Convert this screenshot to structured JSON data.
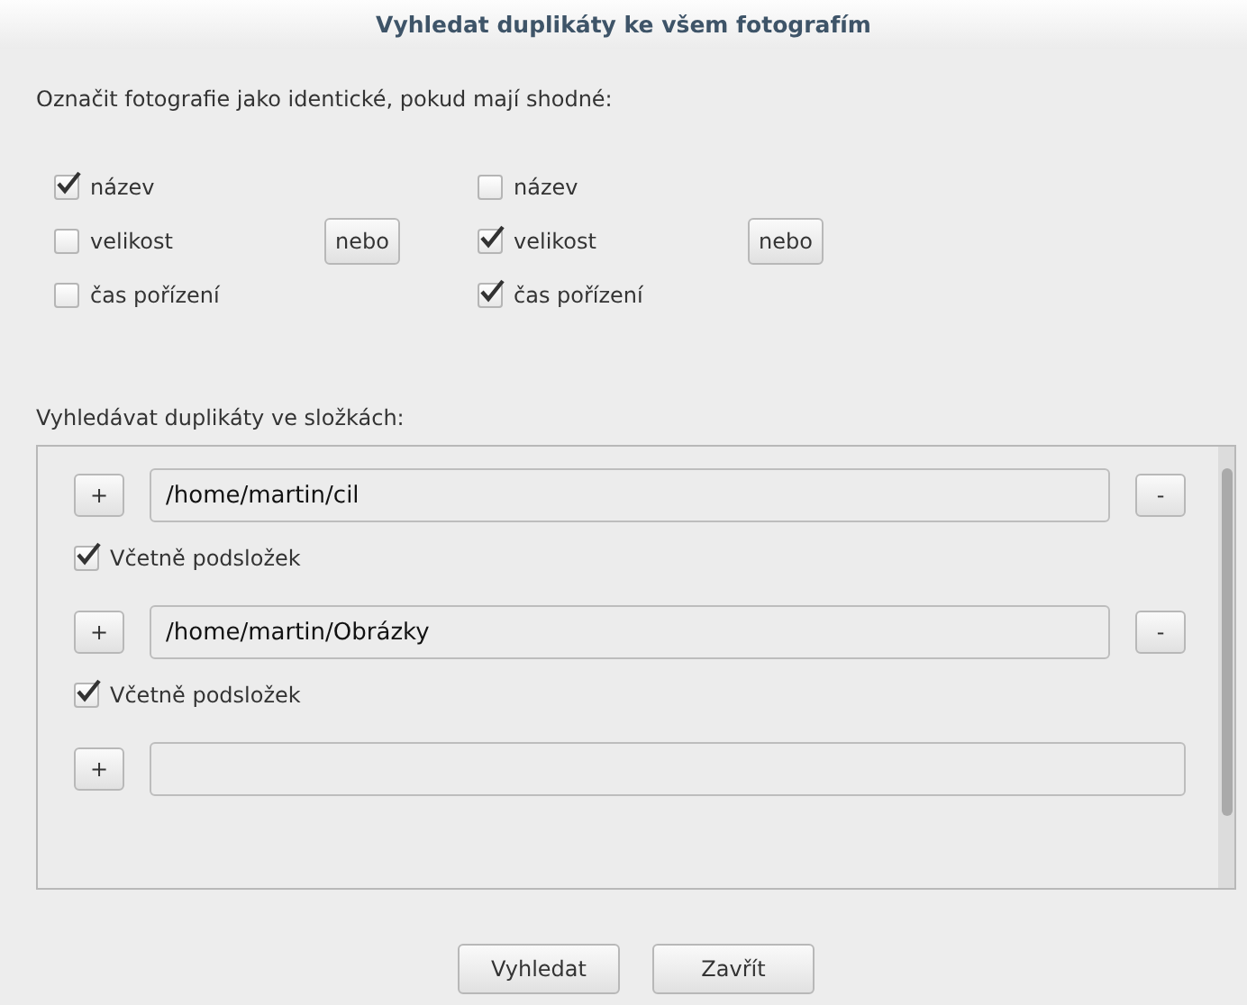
{
  "window": {
    "title": "Vyhledat duplikáty ke všem fotografím"
  },
  "criteria": {
    "label": "Označit fotografie jako identické, pokud mají shodné:",
    "groups": [
      {
        "items": [
          {
            "label": "název",
            "checked": true
          },
          {
            "label": "velikost",
            "checked": false
          },
          {
            "label": "čas pořízení",
            "checked": false
          }
        ],
        "or_button": "nebo"
      },
      {
        "items": [
          {
            "label": "název",
            "checked": false
          },
          {
            "label": "velikost",
            "checked": true
          },
          {
            "label": "čas pořízení",
            "checked": true
          }
        ],
        "or_button": "nebo"
      }
    ]
  },
  "folders": {
    "label": "Vyhledávat duplikáty ve složkách:",
    "entries": [
      {
        "kind": "folder",
        "add": "+",
        "path": "/home/martin/cil",
        "remove": "-",
        "subfolders": {
          "label": "Včetně podsložek",
          "checked": true
        }
      },
      {
        "kind": "folder",
        "add": "+",
        "path": "/home/martin/Obrázky",
        "remove": "-",
        "subfolders": {
          "label": "Včetně podsložek",
          "checked": true
        }
      },
      {
        "kind": "new",
        "add": "+"
      }
    ]
  },
  "buttons": [
    "Vyhledat",
    "Zavřít"
  ]
}
